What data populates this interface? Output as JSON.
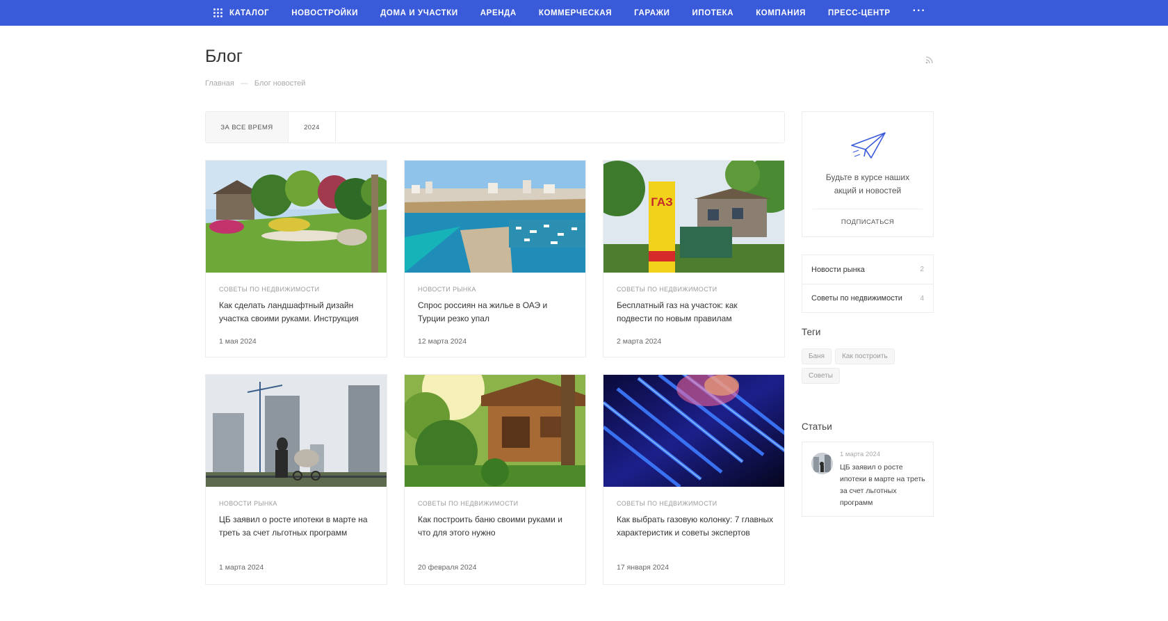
{
  "nav": {
    "items": [
      "Каталог",
      "Новостройки",
      "Дома и участки",
      "Аренда",
      "Коммерческая",
      "Гаражи",
      "Ипотека",
      "Компания",
      "Пресс-центр"
    ],
    "more": "···"
  },
  "page": {
    "title": "Блог",
    "breadcrumb": [
      "Главная",
      "Блог новостей"
    ],
    "breadcrumb_sep": "—"
  },
  "filters": [
    "За все время",
    "2024"
  ],
  "posts": [
    {
      "category": "Советы по недвижимости",
      "title": "Как сделать ландшафтный дизайн участка своими руками. Инструкция",
      "date": "1 мая 2024"
    },
    {
      "category": "Новости рынка",
      "title": "Спрос россиян на жилье в ОАЭ и Турции резко упал",
      "date": "12 марта 2024"
    },
    {
      "category": "Советы по недвижимости",
      "title": "Бесплатный газ на участок: как подвести по новым правилам",
      "date": "2 марта 2024"
    },
    {
      "category": "Новости рынка",
      "title": "ЦБ заявил о росте ипотеки в марте на треть за счет льготных программ",
      "date": "1 марта 2024"
    },
    {
      "category": "Советы по недвижимости",
      "title": "Как построить баню своими руками и что для этого нужно",
      "date": "20 февраля 2024"
    },
    {
      "category": "Советы по недвижимости",
      "title": "Как выбрать газовую колонку: 7 главных характеристик и советы экспертов",
      "date": "17 января 2024"
    }
  ],
  "gas_sign": "ГАЗ",
  "sidebar": {
    "subscribe_text": "Будьте в курсе наших акций и новостей",
    "subscribe_button": "Подписаться",
    "categories": [
      {
        "label": "Новости рынка",
        "count": "2"
      },
      {
        "label": "Советы по недвижимости",
        "count": "4"
      }
    ],
    "tags_heading": "Теги",
    "tags": [
      "Баня",
      "Как построить",
      "Советы"
    ],
    "articles_heading": "Статьи",
    "article": {
      "date": "1 марта 2024",
      "title": "ЦБ заявил о росте ипотеки в марте на треть за счет льготных программ"
    }
  },
  "colors": {
    "nav_bg": "#3a5bd9",
    "accent": "#3a5bd9"
  },
  "icons": {
    "catalog": "grid-icon",
    "rss": "rss-icon",
    "subscribe": "paper-plane-icon"
  }
}
